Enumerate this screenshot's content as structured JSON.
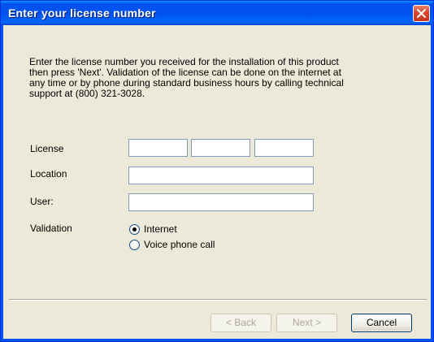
{
  "window": {
    "title": "Enter your license number"
  },
  "description": "Enter the license number you received for the installation of this product\nthen press 'Next'.  Validation of the license can be done on the internet at\nany time or by phone during standard business hours by calling technical\nsupport at (800) 321-3028.",
  "form": {
    "license_label": "License",
    "license_parts": [
      "",
      "",
      ""
    ],
    "location_label": "Location",
    "location_value": "",
    "user_label": "User:",
    "user_value": "",
    "validation_label": "Validation",
    "validation_options": [
      {
        "label": "Internet",
        "selected": true
      },
      {
        "label": "Voice phone call",
        "selected": false
      }
    ]
  },
  "buttons": {
    "back": "< Back",
    "next": "Next >",
    "cancel": "Cancel"
  },
  "colors": {
    "titlebar": "#0053ee",
    "dialog_bg": "#ece9d8",
    "close_button": "#d6472c",
    "input_border": "#7f9db9"
  }
}
